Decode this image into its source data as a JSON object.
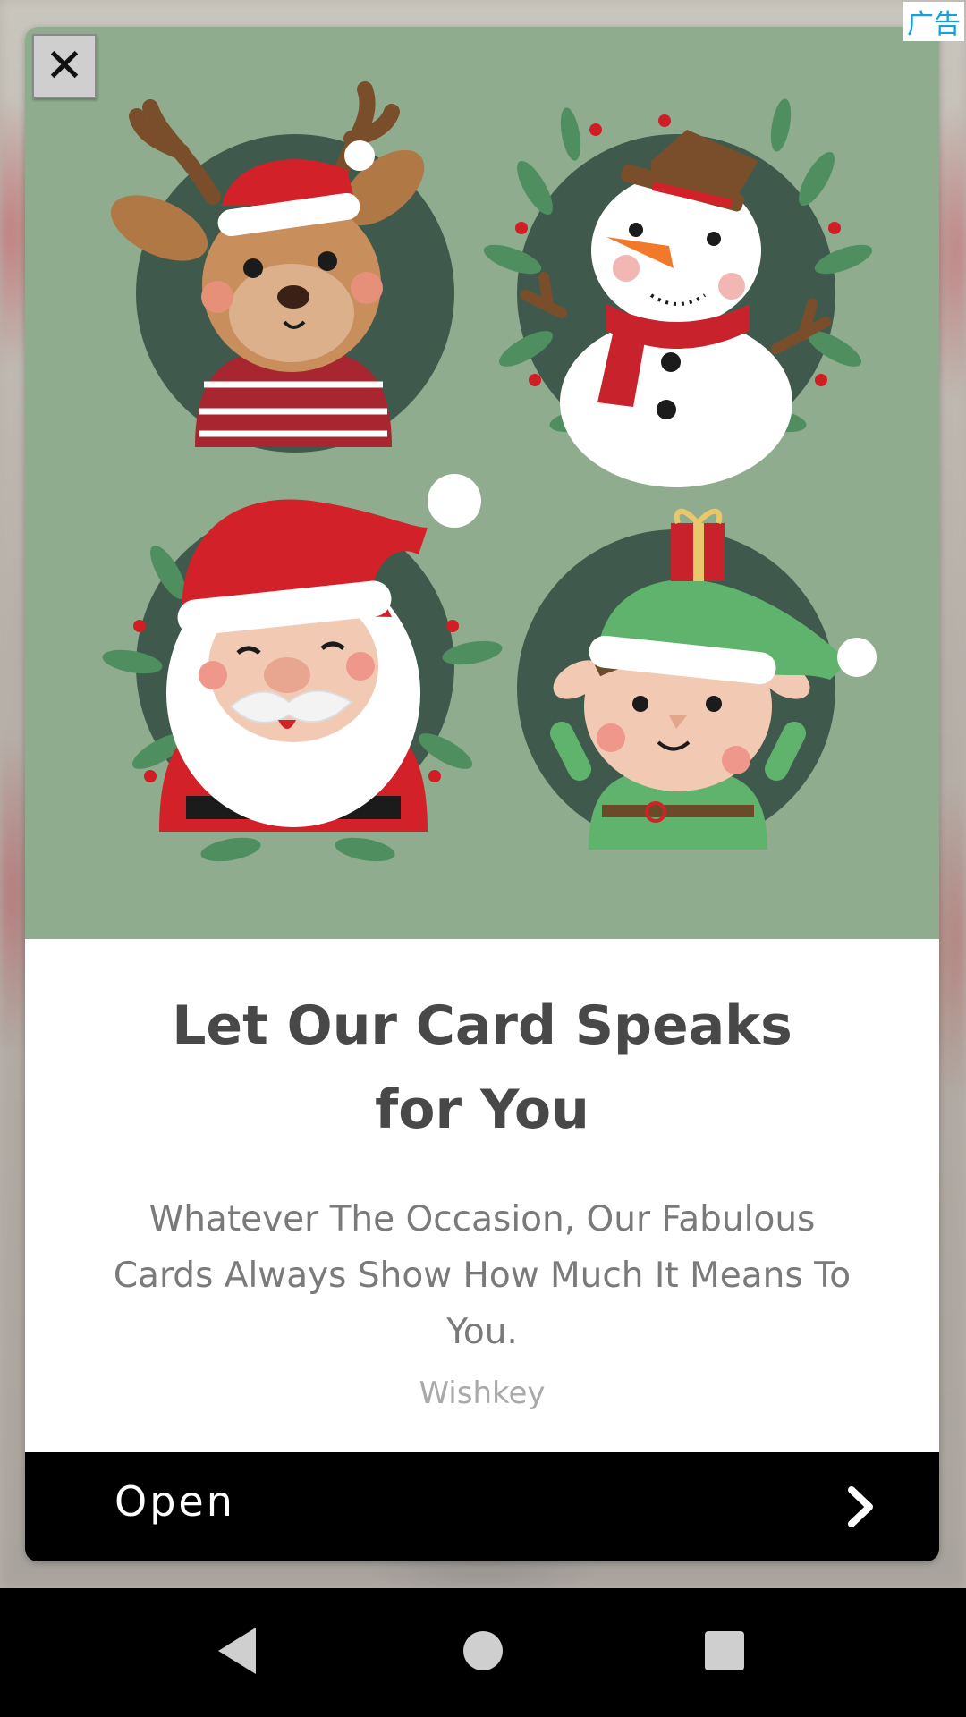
{
  "ad": {
    "badge": "广告",
    "close_symbol": "✕",
    "title": "Let Our Card Speaks for You",
    "description": "Whatever The Occasion, Our Fabulous Cards Always Show How Much It Means To You.",
    "advertiser": "Wishkey",
    "cta_label": "Open",
    "hero_bg_color": "#8fad8e",
    "hero_circle_color": "#3f5a4c"
  },
  "icons": {
    "cta": "chevron-right-icon",
    "nav_back": "back-triangle-icon",
    "nav_home": "home-circle-icon",
    "nav_recents": "recents-square-icon"
  }
}
